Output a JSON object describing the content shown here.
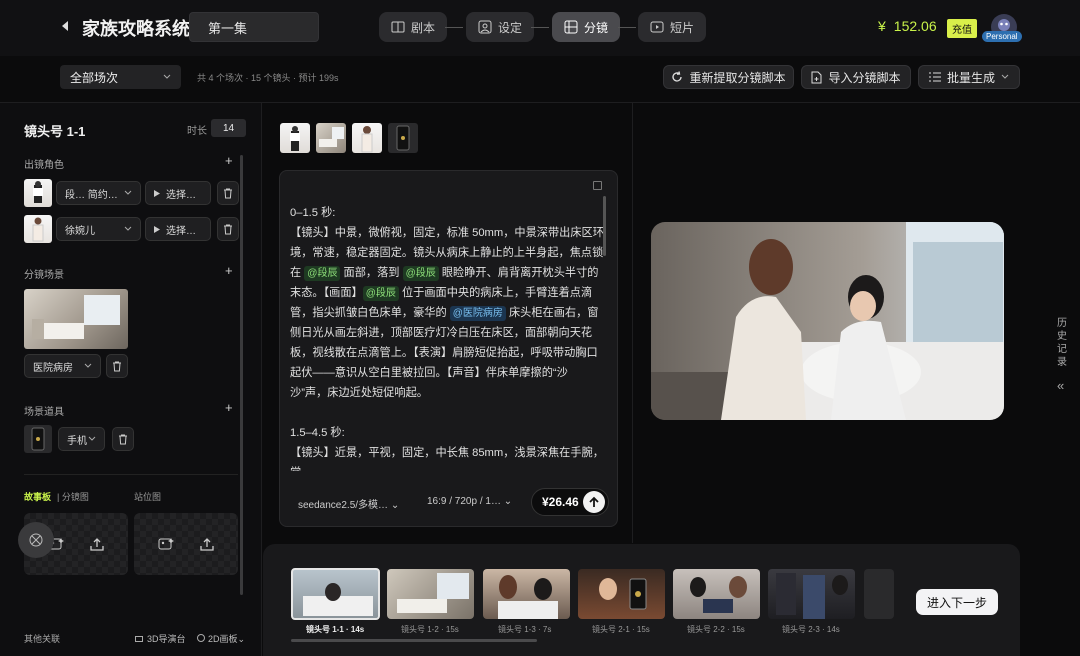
{
  "header": {
    "app_title": "家族攻略系统",
    "episode": "第一集",
    "steps": [
      {
        "label": "剧本",
        "icon": "book-icon"
      },
      {
        "label": "设定",
        "icon": "settings-card-icon"
      },
      {
        "label": "分镜",
        "icon": "storyboard-grid-icon",
        "active": true
      },
      {
        "label": "短片",
        "icon": "play-icon"
      }
    ],
    "balance_symbol": "¥",
    "balance": "152.06",
    "recharge_label": "充值",
    "user_badge": "Personal"
  },
  "toolbar": {
    "scene_select": "全部场次",
    "summary": "共 4 个场次 · 15 个镜头 · 预计 199s",
    "reextract_label": "重新提取分镜脚本",
    "import_label": "导入分镜脚本",
    "batch_label": "批量生成"
  },
  "shot_panel": {
    "title": "镜头号 1-1",
    "duration_label": "时长",
    "duration_value": "14",
    "characters_label": "出镜角色",
    "characters": [
      {
        "name": "段…  简约…",
        "select_label": "选择…"
      },
      {
        "name": "徐婉儿",
        "select_label": "选择…"
      }
    ],
    "scene_label": "分镜场景",
    "scene_name": "医院病房",
    "props_label": "场景道具",
    "prop_name": "手机",
    "tab_storyboard": "故事板",
    "tab_split": "| 分镜图",
    "tab_standin": "站位图",
    "other_label": "其他关联",
    "stage3d_label": "3D导演台",
    "canvas2d_label": "2D画板"
  },
  "prompt": {
    "line1": "0–1.5 秒:",
    "seg_a": "【镜头】中景，微俯视，固定，标准 50mm，中景深带出床区环境，常速，稳定器固定。镜头从病床上静止的上半身起，焦点锁在 ",
    "tag1": "@段辰",
    "seg_b": " 面部，落到 ",
    "tag2": "@段辰",
    "seg_c": " 眼睑睁开、肩背离开枕头半寸的末态。【画面】",
    "tag3": "@段辰",
    "seg_d": " 位于画面中央的病床上，手臂连着点滴管，指尖抓皱白色床单，豪华的 ",
    "tag4": "@医院病房",
    "seg_e": " 床头柜在画右，窗侧日光从画左斜进，顶部医疗灯冷白压在床区，面部朝向天花板，视线散在点滴管上。【表演】肩膀短促抬起，呼吸带动胸口起伏——意识从空白里被拉回。【声音】伴床单摩擦的“沙沙”声，床边近处短促响起。",
    "line2": "1.5–4.5 秒:",
    "line3": "【镜头】近景，平视，固定，中长焦 85mm，浅景深焦在手腕，常"
  },
  "generation": {
    "model": "seedance2.5/多模…",
    "ratio": "16:9 / 720p / 1…",
    "price": "¥26.46"
  },
  "history_label": "历史记录",
  "next_label": "进入下一步",
  "shots": [
    {
      "label": "镜头号 1-1 · 14s",
      "active": true
    },
    {
      "label": "镜头号 1-2 · 15s"
    },
    {
      "label": "镜头号 1-3 · 7s"
    },
    {
      "label": "镜头号 2-1 · 15s"
    },
    {
      "label": "镜头号 2-2 · 15s"
    },
    {
      "label": "镜头号 2-3 · 14s"
    }
  ],
  "colors": {
    "accent": "#c8f24a",
    "panel": "#19191b",
    "background": "#0b0b0c"
  }
}
